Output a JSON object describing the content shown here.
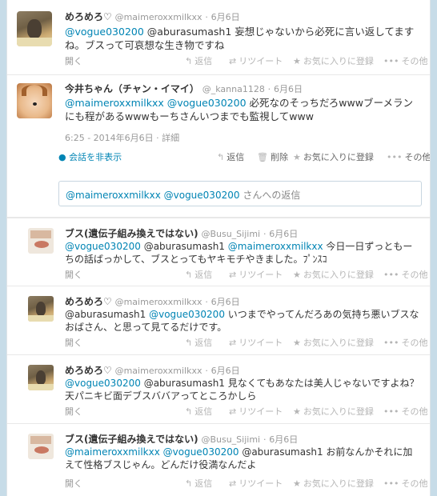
{
  "tweets": [
    {
      "name": "めろめろ♡",
      "screen": "@maimeroxxmilkxx",
      "time": "6月6日",
      "text_mentions": [
        "@vogue030200"
      ],
      "text_body": "@aburasumash1 妄想じゃないから必死に言い返してますね。ブスって可哀想な生き物ですね",
      "open": "開く",
      "reply": "返信",
      "retweet": "リツイート",
      "fav": "お気に入りに登録",
      "more": "その他"
    },
    {
      "name": "今井ちゃん（チャン・イマイ）",
      "screen": "@_kanna1128",
      "time": "6月6日",
      "text_mentions": [
        "@maimeroxxmilkxx",
        "@vogue030200"
      ],
      "text_body": "必死なのそっちだろwwwブーメランにも程があるwwwもーちさんいつまでも監視してwww",
      "timestamp": "6:25 - 2014年6月6日",
      "details": "詳細",
      "hide_conversation": "会話を非表示",
      "reply": "返信",
      "delete": "削除",
      "fav": "お気に入りに登録",
      "more": "その他"
    },
    {
      "name": "ブス(遺伝子組み換えではない)",
      "screen": "@Busu_Sijimi",
      "time": "6月6日",
      "text_mentions": [
        "@vogue030200"
      ],
      "text_middle": "@aburasumash1",
      "text_mention2": "@maimeroxxmilkxx",
      "text_body": "今日一日ずっともーちの話ばっかして、ブスとってもヤキモチやきました。ﾌﾟﾝｽｺ",
      "open": "開く",
      "reply": "返信",
      "retweet": "リツイート",
      "fav": "お気に入りに登録",
      "more": "その他"
    },
    {
      "name": "めろめろ♡",
      "screen": "@maimeroxxmilkxx",
      "time": "6月6日",
      "text_pre": "@aburasumash1",
      "text_mentions": [
        "@vogue030200"
      ],
      "text_body": "いつまでやってんだろあの気持ち悪いブスなおばさん、と思って見てるだけです。",
      "open": "開く",
      "reply": "返信",
      "retweet": "リツイート",
      "fav": "お気に入りに登録",
      "more": "その他"
    },
    {
      "name": "めろめろ♡",
      "screen": "@maimeroxxmilkxx",
      "time": "6月6日",
      "text_mentions": [
        "@vogue030200"
      ],
      "text_body": "@aburasumash1 見なくてもあなたは美人じゃないですよね？天パニキビ面デブスババアってところかしら",
      "open": "開く",
      "reply": "返信",
      "retweet": "リツイート",
      "fav": "お気に入りに登録",
      "more": "その他"
    },
    {
      "name": "ブス(遺伝子組み換えではない)",
      "screen": "@Busu_Sijimi",
      "time": "6月6日",
      "text_mentions": [
        "@maimeroxxmilkxx",
        "@vogue030200"
      ],
      "text_body": "@aburasumash1 お前なんかそれに加えて性格ブスじゃん。どんだけ役満なんだよ",
      "open": "開く",
      "reply": "返信",
      "retweet": "リツイート",
      "fav": "お気に入りに登録",
      "more": "その他"
    }
  ],
  "reply_box": {
    "mentions": "@maimeroxxmilkxx @vogue030200",
    "suffix": "さんへの返信"
  },
  "dot": "·",
  "colors": {
    "link": "#0084b4",
    "muted": "#999999",
    "background": "#c7dce8"
  }
}
